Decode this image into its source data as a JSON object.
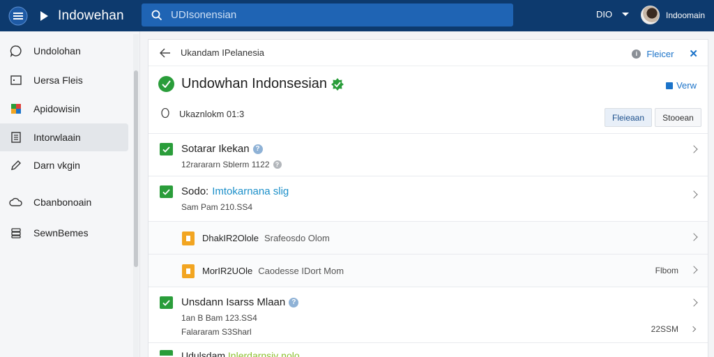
{
  "header": {
    "app_title": "Indowehan",
    "search_placeholder": "UDIsonensian",
    "language": "DIO",
    "user_name": "Indoomain"
  },
  "sidebar": {
    "items": [
      {
        "label": "Undolohan",
        "icon": "chat-bubble-icon"
      },
      {
        "label": "Uersa Fleis",
        "icon": "frame-icon"
      },
      {
        "label": "Apidowisin",
        "icon": "app-tile-icon"
      },
      {
        "label": "Intorwlaain",
        "icon": "list-doc-icon"
      },
      {
        "label": "Darn vkgin",
        "icon": "pen-icon"
      },
      {
        "label": "Cbanbonoain",
        "icon": "cloud-icon"
      },
      {
        "label": "SewnBemes",
        "icon": "stack-icon"
      }
    ],
    "active_index": 3
  },
  "panel": {
    "breadcrumb": "Ukandam IPelanesia",
    "filter_label": "Fleicer",
    "title": "Undowhan Indonsesian",
    "view_label": "Verw",
    "subtitle": "Ukaznlokm 01:3",
    "primary_button": "Fleieaan",
    "secondary_button": "Stooean"
  },
  "rows": [
    {
      "title": "Sotarar Ikekan",
      "meta": "12rarararn Sblerm 1122"
    },
    {
      "title": "Sodo:",
      "title_link": "Imtokarnana slig",
      "meta": "Sam Pam 210.SS4"
    },
    {
      "label": "DhakIR2Olole",
      "label_muted": "Srafeosdo Olom"
    },
    {
      "label": "MorIR2UOle",
      "label_muted": "Caodesse IDort Mom",
      "right": "Flbom"
    },
    {
      "title": "Unsdann Isarss Mlaan",
      "meta": "1an B Bam 123.SS4",
      "meta2": "Falararam S3Sharl",
      "right": "22SSM"
    },
    {
      "title": "Udulsdam",
      "title_link": "Inlerdarnsiv nolo"
    }
  ],
  "colors": {
    "topbar": "#0d3a6e",
    "search": "#1f64b4",
    "accent": "#1b73c9",
    "success": "#2a9d3a",
    "warning": "#f2a521"
  }
}
